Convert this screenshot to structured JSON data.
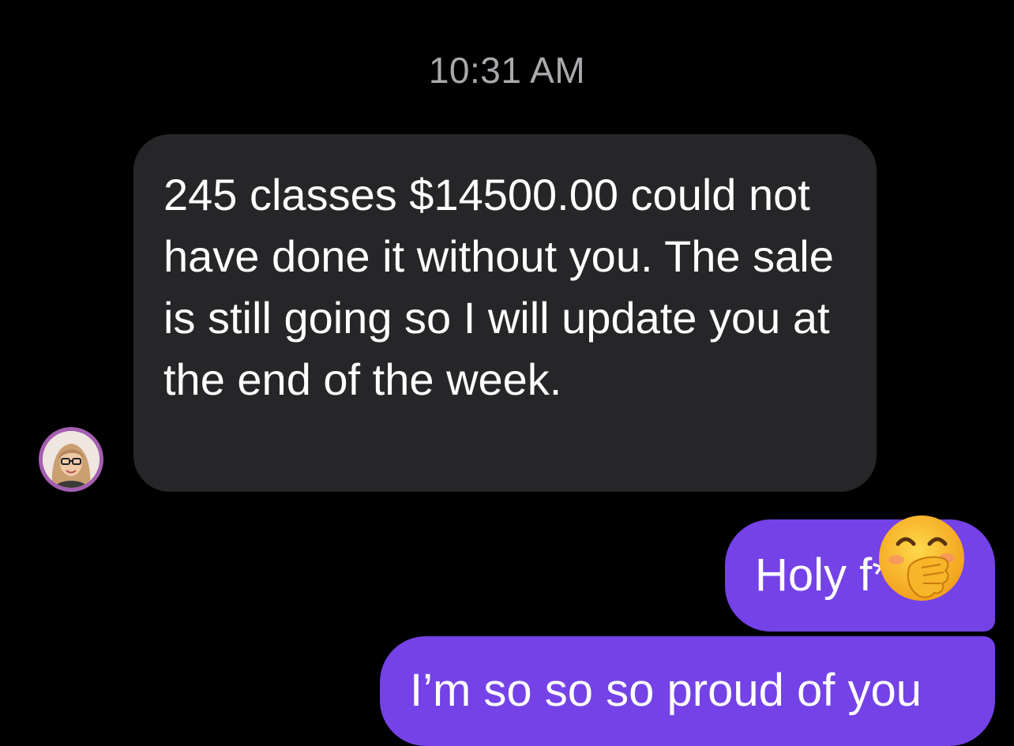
{
  "timestamp": "10:31 AM",
  "incoming": {
    "text": "245 classes $14500.00 could not have done it without you. The sale is still going so I will update you at the end of the week."
  },
  "outgoing": [
    {
      "text": "Holy f**k"
    },
    {
      "text": "I’m so so so proud of you"
    }
  ],
  "reaction": {
    "icon": "hand-over-mouth-emoji-icon"
  },
  "colors": {
    "background": "#000000",
    "incoming_bubble": "#262628",
    "outgoing_bubble": "#7442e6",
    "timestamp_text": "#a9a9ad",
    "avatar_ring": "#a35fb0"
  }
}
